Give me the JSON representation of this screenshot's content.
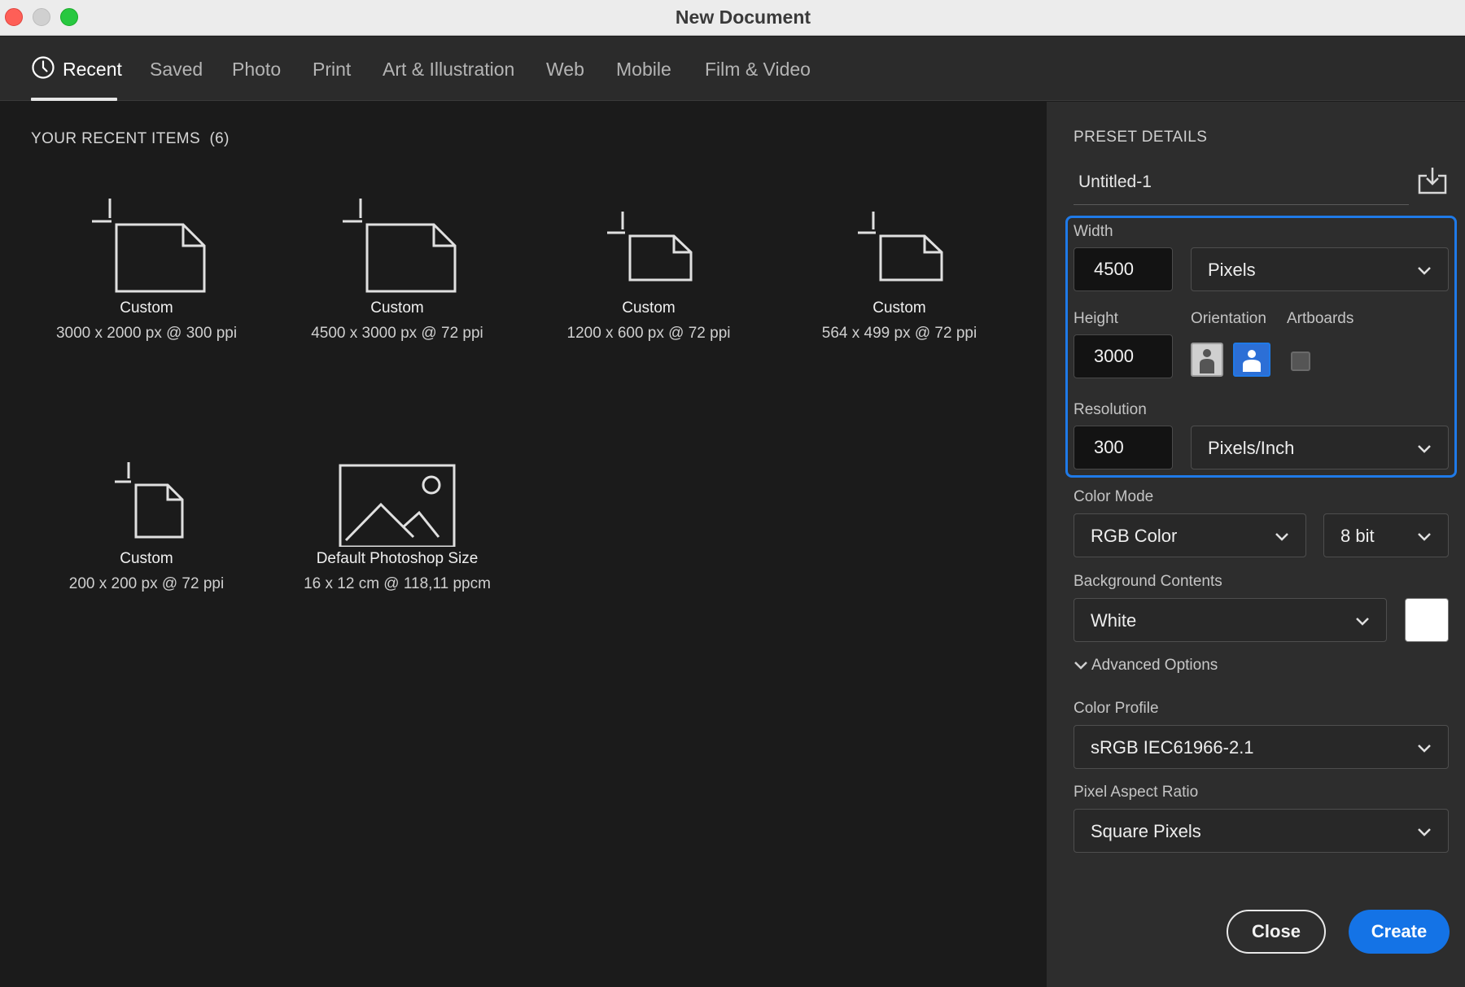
{
  "window": {
    "title": "New Document"
  },
  "tabs": [
    {
      "label": "Recent",
      "active": true
    },
    {
      "label": "Saved"
    },
    {
      "label": "Photo"
    },
    {
      "label": "Print"
    },
    {
      "label": "Art & Illustration"
    },
    {
      "label": "Web"
    },
    {
      "label": "Mobile"
    },
    {
      "label": "Film & Video"
    }
  ],
  "recent": {
    "header": "YOUR RECENT ITEMS  (6)",
    "items": [
      {
        "name": "Custom",
        "meta": "3000 x 2000 px @ 300 ppi",
        "icon": "new-document-icon"
      },
      {
        "name": "Custom",
        "meta": "4500 x 3000 px @ 72 ppi",
        "icon": "new-document-icon"
      },
      {
        "name": "Custom",
        "meta": "1200 x 600 px @ 72 ppi",
        "icon": "new-document-icon"
      },
      {
        "name": "Custom",
        "meta": "564 x 499 px @ 72 ppi",
        "icon": "new-document-icon"
      },
      {
        "name": "Custom",
        "meta": "200 x 200 px @ 72 ppi",
        "icon": "new-document-icon"
      },
      {
        "name": "Default Photoshop Size",
        "meta": "16 x 12 cm @ 118,11 ppcm",
        "icon": "image-placeholder-icon"
      }
    ]
  },
  "preset": {
    "header": "PRESET DETAILS",
    "doc_name": "Untitled-1",
    "width_label": "Width",
    "width_value": "4500",
    "width_unit": "Pixels",
    "height_label": "Height",
    "height_value": "3000",
    "orientation_label": "Orientation",
    "orientation_selected": "landscape",
    "artboards_label": "Artboards",
    "artboards_checked": false,
    "resolution_label": "Resolution",
    "resolution_value": "300",
    "resolution_unit": "Pixels/Inch",
    "color_mode_label": "Color Mode",
    "color_mode": "RGB Color",
    "bit_depth": "8 bit",
    "bg_label": "Background Contents",
    "bg_value": "White",
    "bg_swatch_color": "#ffffff",
    "advanced_label": "Advanced Options",
    "color_profile_label": "Color Profile",
    "color_profile": "sRGB IEC61966-2.1",
    "pixel_aspect_label": "Pixel Aspect Ratio",
    "pixel_aspect": "Square Pixels"
  },
  "buttons": {
    "close": "Close",
    "create": "Create"
  },
  "colors": {
    "accent": "#1473e6",
    "highlight_border": "#1f7ae8"
  }
}
